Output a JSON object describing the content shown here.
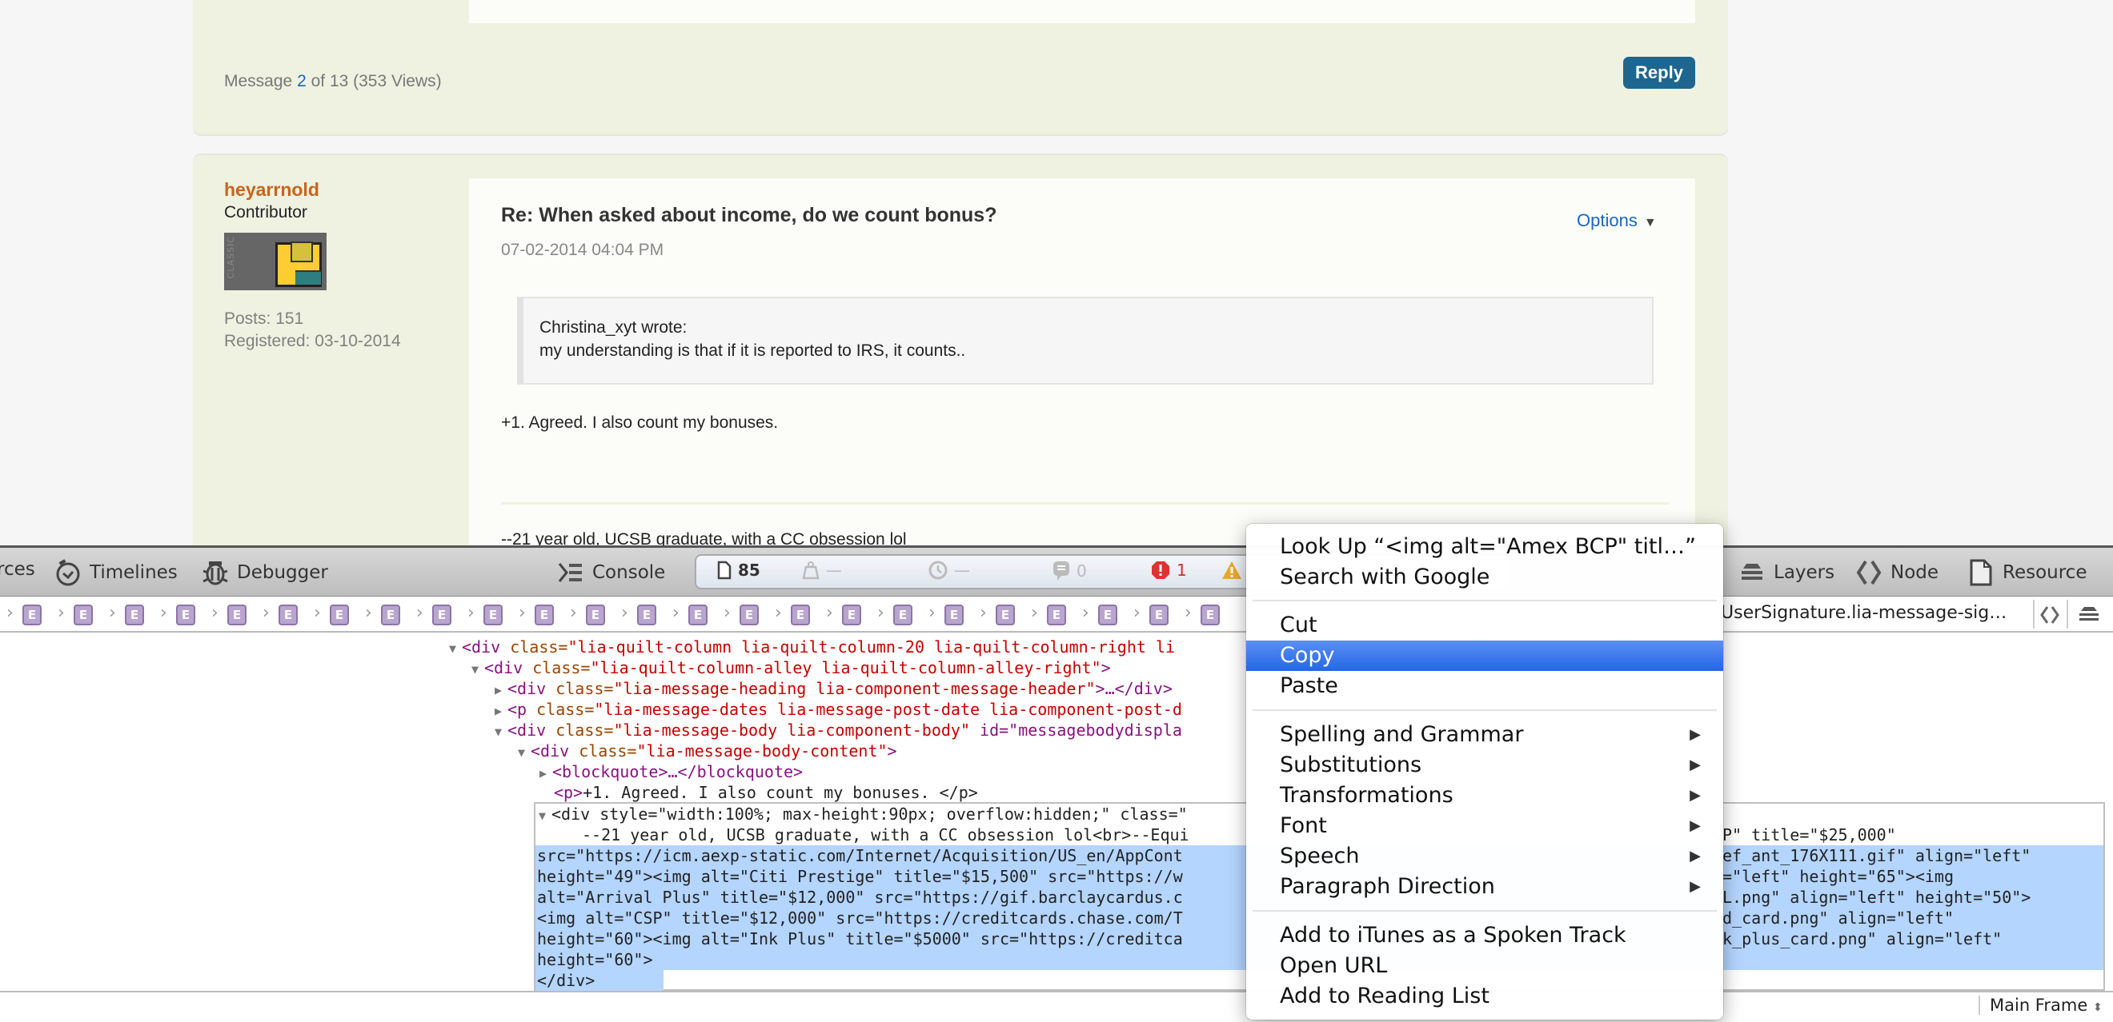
{
  "forum": {
    "prev_post": {
      "message_prefix": "Message",
      "message_number": "2",
      "message_suffix": "of 13 (353 Views)",
      "reply_label": "Reply"
    },
    "post": {
      "username": "heyarrnold",
      "rank": "Contributor",
      "avatar_label": "CLASSIC",
      "posts": "Posts: 151",
      "registered": "Registered: 03-10-2014",
      "title": "Re: When asked about income, do we count bonus?",
      "date": "07-02-2014 04:04 PM",
      "options_label": "Options",
      "quote_author": "Christina_xyt wrote:",
      "quote_text": "my understanding is that if it is reported to IRS, it counts..",
      "body": "+1. Agreed. I also count my bonuses.",
      "signature": "--21 year old, UCSB graduate, with a CC obsession lol"
    }
  },
  "devtools": {
    "toolbar": {
      "resources_label": "rces",
      "timelines_label": "Timelines",
      "debugger_label": "Debugger",
      "console_label": "Console",
      "layers_label": "Layers",
      "node_label": "Node",
      "resource_label": "Resource"
    },
    "dashboard": {
      "resources_count": "85",
      "size": "—",
      "time": "—",
      "logs": "0",
      "errors": "1"
    },
    "breadcrumb": {
      "element_glyph": "E",
      "last_label": "UserSignature.lia-message-sig…"
    },
    "dom_tree": [
      {
        "tag": "<div",
        "attr": " class=",
        "val": "\"lia-quilt-column lia-quilt-column-20 lia-quilt-column-right li",
        "end": "",
        "arrow": "▼"
      },
      {
        "tag": "<div",
        "attr": " class=",
        "val": "\"lia-quilt-column-alley lia-quilt-column-alley-right\"",
        "end": ">",
        "arrow": "▼"
      },
      {
        "tag": "<div",
        "attr": " class=",
        "val": "\"lia-message-heading lia-component-message-header\"",
        "end": ">…</div>",
        "arrow": "▶"
      },
      {
        "tag": "<p",
        "attr": " class=",
        "val": "\"lia-message-dates lia-message-post-date lia-component-post-d",
        "end": "",
        "arrow": "▶"
      },
      {
        "tag": "<div",
        "attr": " class=",
        "val": "\"lia-message-body lia-component-body\"",
        "end": " id=\"messagebodydispla",
        "arrow": "▼"
      },
      {
        "tag": "<div",
        "attr": " class=",
        "val": "\"lia-message-body-content\"",
        "end": ">",
        "arrow": "▼"
      },
      {
        "tag": "<blockquote",
        "attr": "",
        "val": "",
        "end": ">…</blockquote>",
        "arrow": "▶"
      },
      {
        "tag": "<p>",
        "attr": "",
        "val": "",
        "end": "+1. Agreed. I also count my bonuses. </p>",
        "arrow": ""
      }
    ],
    "selected_node": {
      "line0": "<div style=\"width:100%; max-height:90px; overflow:hidden;\" class=\"",
      "line1": "--21 year old, UCSB graduate, with a CC obsession lol<br>--Equi",
      "line2": "src=\"https://icm.aexp-static.com/Internet/Acquisition/US_en/AppCont",
      "line3": "height=\"49\"><img alt=\"Citi Prestige\" title=\"$15,500\" src=\"https://w",
      "line4": "alt=\"Arrival Plus\" title=\"$12,000\" src=\"https://gif.barclaycardus.c",
      "line5": "<img alt=\"CSP\" title=\"$12,000\" src=\"https://creditcards.chase.com/T",
      "line6": "height=\"60\"><img alt=\"Ink Plus\" title=\"$5000\" src=\"https://creditca",
      "line7": "height=\"60\">",
      "line8": "</div>",
      "right1": "P\" title=\"$25,000\"",
      "right2": "ef_ant_176X111.gif\" align=\"left\"",
      "right3": "=\"left\" height=\"65\"><img",
      "right4": "L.png\" align=\"left\" height=\"50\">",
      "right5": "d_card.png\" align=\"left\"",
      "right6": "k_plus_card.png\" align=\"left\""
    },
    "status": {
      "frame_label": "Main Frame"
    }
  },
  "context_menu": {
    "items": [
      {
        "label": "Look Up “<img alt=\"Amex BCP\" titl…”"
      },
      {
        "label": "Search with Google"
      },
      {
        "label": "Cut"
      },
      {
        "label": "Copy",
        "selected": true
      },
      {
        "label": "Paste"
      },
      {
        "label": "Spelling and Grammar",
        "submenu": true
      },
      {
        "label": "Substitutions",
        "submenu": true
      },
      {
        "label": "Transformations",
        "submenu": true
      },
      {
        "label": "Font",
        "submenu": true
      },
      {
        "label": "Speech",
        "submenu": true
      },
      {
        "label": "Paragraph Direction",
        "submenu": true
      },
      {
        "label": "Add to iTunes as a Spoken Track"
      },
      {
        "label": "Open URL"
      },
      {
        "label": "Add to Reading List"
      }
    ],
    "submenu_glyph": "▶"
  },
  "colors": {
    "post_bg": "#eff2e1",
    "link_blue": "#1b64c8",
    "username_orange": "#c8641c",
    "reply_button": "#1c6690",
    "menu_selection": "#2f6fea",
    "dom_selection": "#b4d5fe"
  }
}
